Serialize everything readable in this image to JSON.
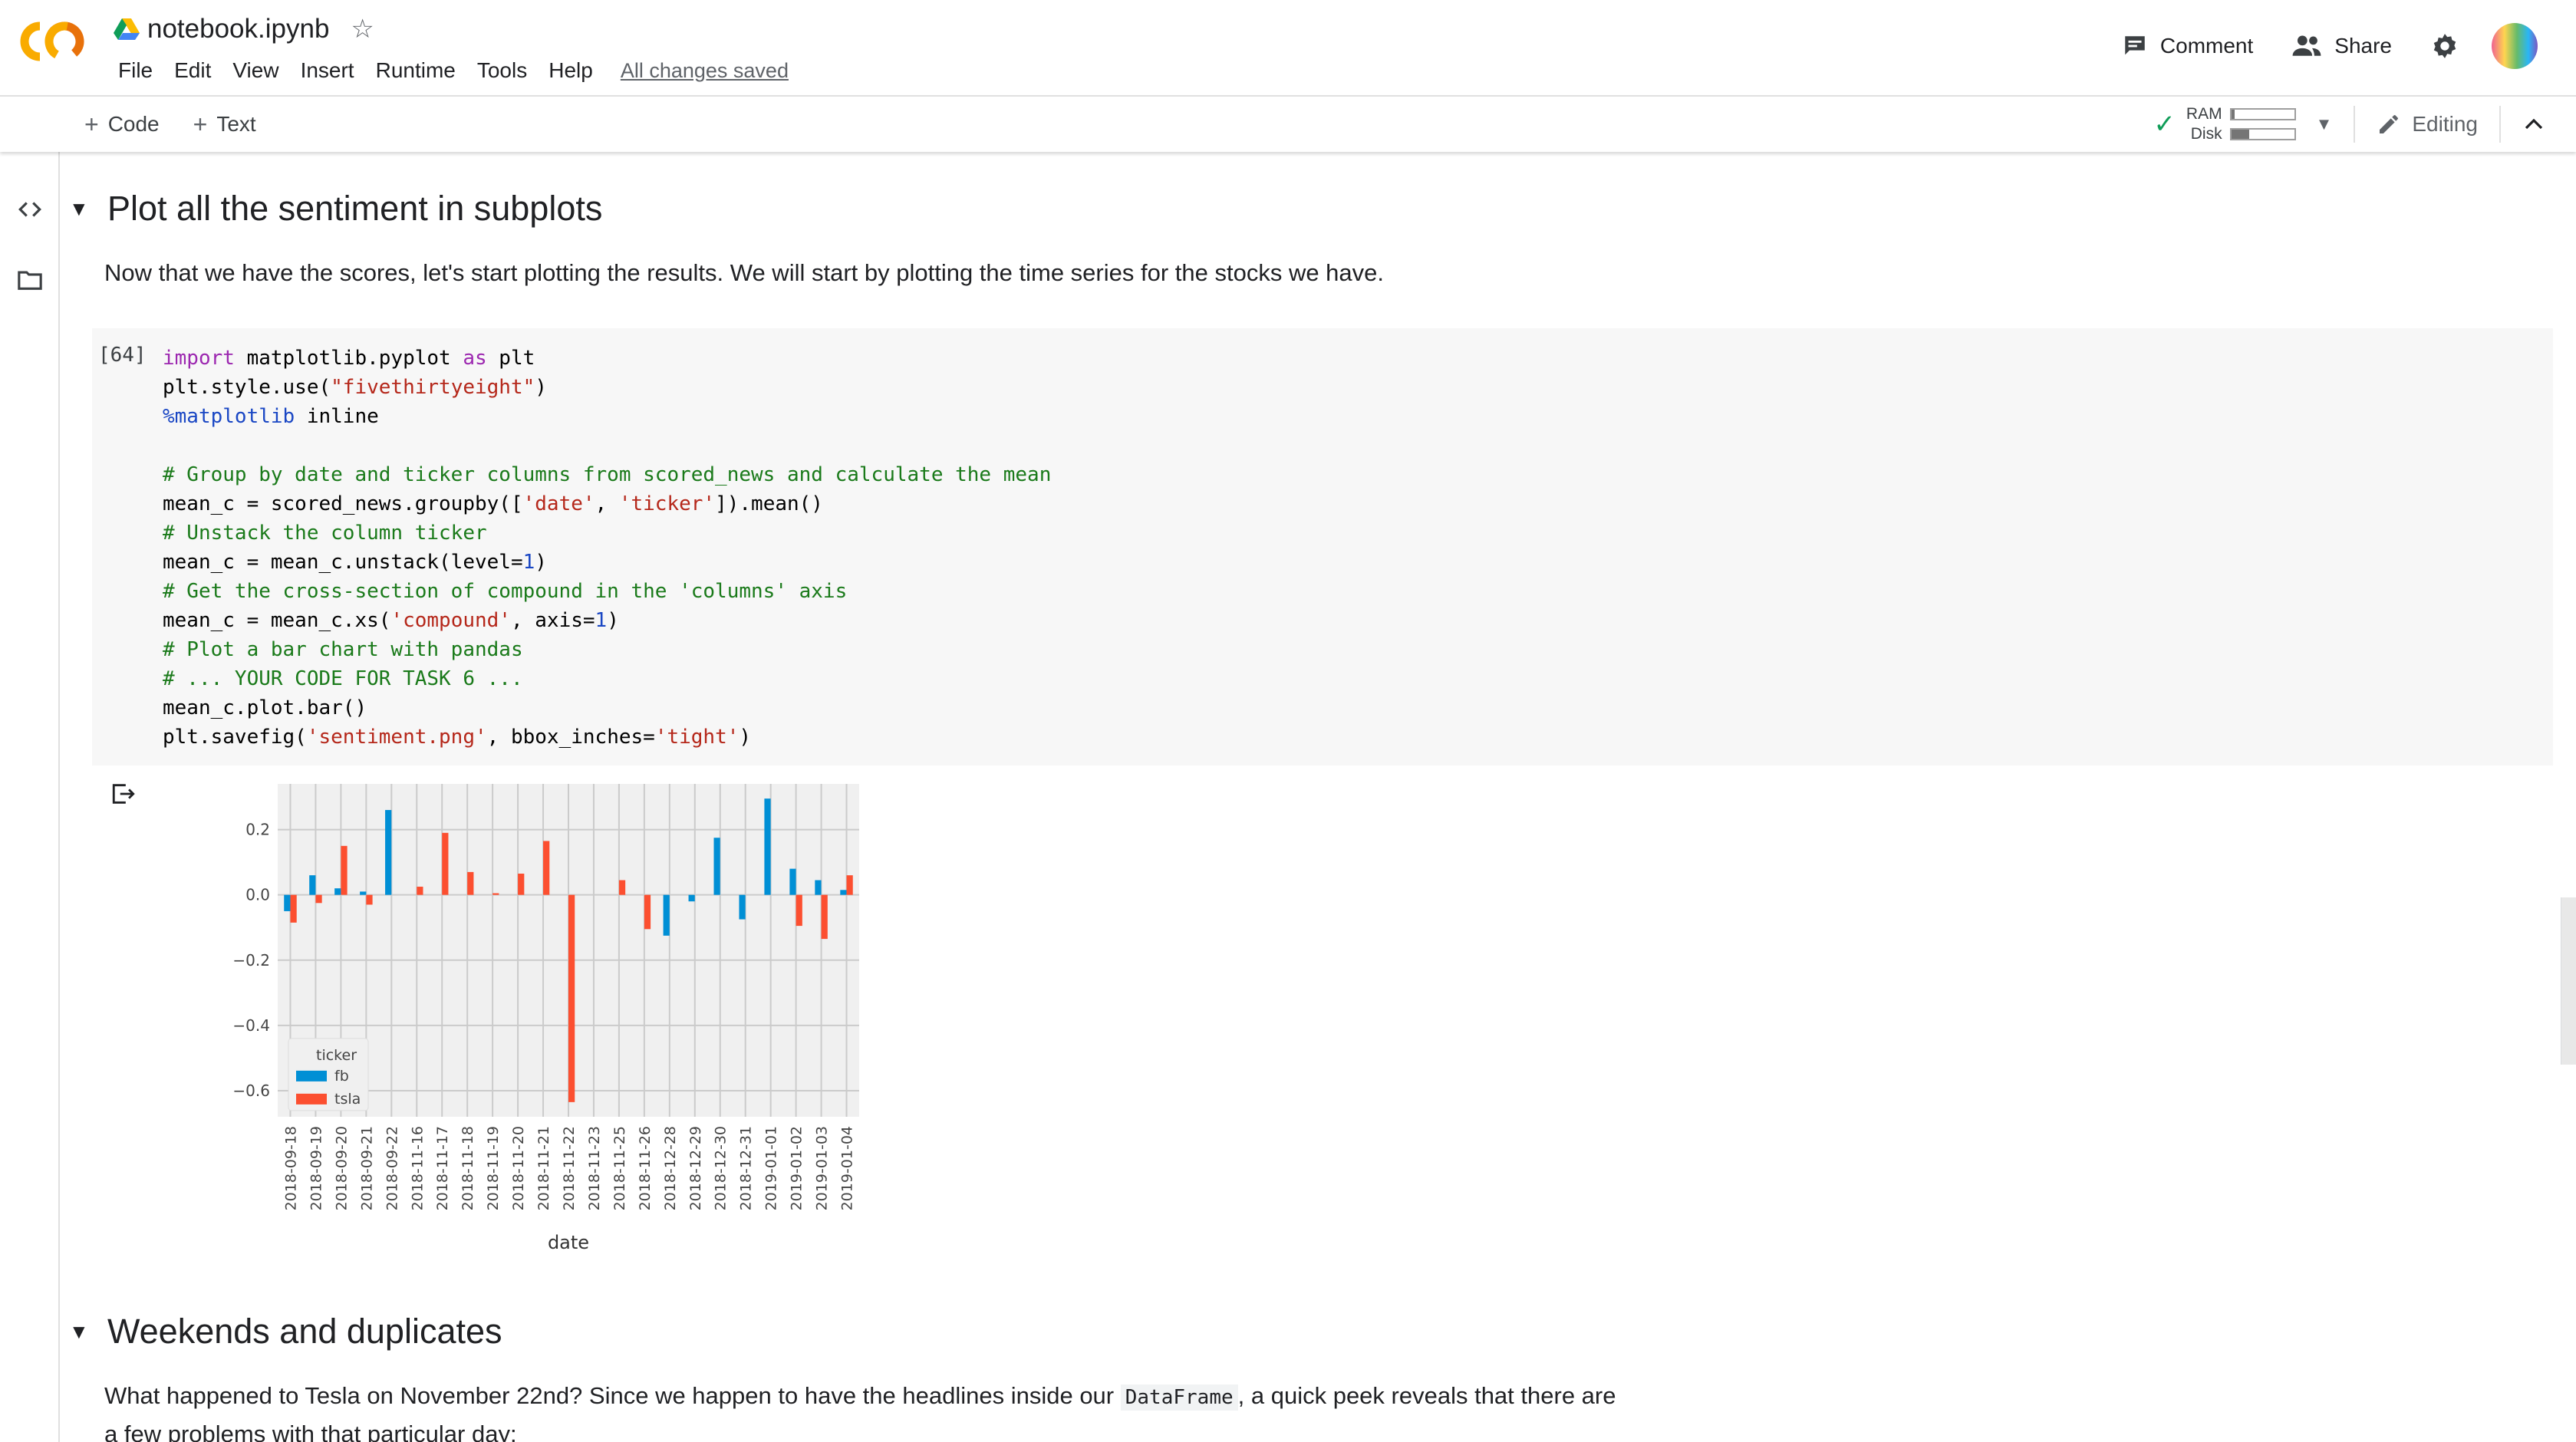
{
  "app": {
    "notebook_title": "notebook.ipynb",
    "menu": [
      "File",
      "Edit",
      "View",
      "Insert",
      "Runtime",
      "Tools",
      "Help"
    ],
    "save_status": "All changes saved",
    "comment_label": "Comment",
    "share_label": "Share"
  },
  "toolbar": {
    "code_label": "Code",
    "text_label": "Text",
    "ram_label": "RAM",
    "disk_label": "Disk",
    "ram_fill": 0.05,
    "disk_fill": 0.28,
    "editing_label": "Editing"
  },
  "section1": {
    "title": "Plot all the sentiment in subplots",
    "text": "Now that we have the scores, let's start plotting the results. We will start by plotting the time series for the stocks we have."
  },
  "code_cell": {
    "exec_count": "[64]",
    "lines": [
      [
        [
          "kw",
          "import"
        ],
        [
          "t",
          " matplotlib.pyplot "
        ],
        [
          "kw",
          "as"
        ],
        [
          "t",
          " plt"
        ]
      ],
      [
        [
          "t",
          "plt.style.use("
        ],
        [
          "str",
          "\"fivethirtyeight\""
        ],
        [
          "t",
          ")"
        ]
      ],
      [
        [
          "magic",
          "%matplotlib"
        ],
        [
          "t",
          " inline"
        ]
      ],
      [],
      [
        [
          "cm",
          "# Group by date and ticker columns from scored_news and calculate the mean"
        ]
      ],
      [
        [
          "t",
          "mean_c = scored_news.groupby(["
        ],
        [
          "str",
          "'date'"
        ],
        [
          "t",
          ", "
        ],
        [
          "str",
          "'ticker'"
        ],
        [
          "t",
          "]).mean()"
        ]
      ],
      [
        [
          "cm",
          "# Unstack the column ticker"
        ]
      ],
      [
        [
          "t",
          "mean_c = mean_c.unstack(level="
        ],
        [
          "num",
          "1"
        ],
        [
          "t",
          ")"
        ]
      ],
      [
        [
          "cm",
          "# Get the cross-section of compound in the 'columns' axis"
        ]
      ],
      [
        [
          "t",
          "mean_c = mean_c.xs("
        ],
        [
          "str",
          "'compound'"
        ],
        [
          "t",
          ", axis="
        ],
        [
          "num",
          "1"
        ],
        [
          "t",
          ")"
        ]
      ],
      [
        [
          "cm",
          "# Plot a bar chart with pandas"
        ]
      ],
      [
        [
          "cm",
          "# ... YOUR CODE FOR TASK 6 ..."
        ]
      ],
      [
        [
          "t",
          "mean_c.plot.bar()"
        ]
      ],
      [
        [
          "t",
          "plt.savefig("
        ],
        [
          "str",
          "'sentiment.png'"
        ],
        [
          "t",
          ", bbox_inches="
        ],
        [
          "str",
          "'tight'"
        ],
        [
          "t",
          ")"
        ]
      ]
    ]
  },
  "chart_data": {
    "type": "bar",
    "categories": [
      "2018-09-18",
      "2018-09-19",
      "2018-09-20",
      "2018-09-21",
      "2018-09-22",
      "2018-11-16",
      "2018-11-17",
      "2018-11-18",
      "2018-11-19",
      "2018-11-20",
      "2018-11-21",
      "2018-11-22",
      "2018-11-23",
      "2018-11-25",
      "2018-11-26",
      "2018-12-28",
      "2018-12-29",
      "2018-12-30",
      "2018-12-31",
      "2019-01-01",
      "2019-01-02",
      "2019-01-03",
      "2019-01-04"
    ],
    "series": [
      {
        "name": "fb",
        "color": "#008fd5",
        "values": [
          -0.05,
          0.06,
          0.02,
          0.01,
          0.26,
          0,
          0,
          0,
          0,
          0,
          0,
          0,
          0,
          0,
          0,
          -0.125,
          -0.02,
          0.175,
          -0.075,
          0.295,
          0.08,
          0.045,
          0.015
        ]
      },
      {
        "name": "tsla",
        "color": "#fc4f30",
        "values": [
          -0.085,
          -0.025,
          0.15,
          -0.03,
          0,
          0.025,
          0.19,
          0.07,
          0.005,
          0.065,
          0.165,
          -0.635,
          0,
          0.045,
          -0.105,
          0,
          0,
          0,
          0,
          0,
          -0.095,
          -0.135,
          0.06
        ]
      }
    ],
    "xlabel": "date",
    "ylabel": "",
    "ylim": [
      -0.68,
      0.34
    ],
    "yticks": [
      "0.2",
      "0.0",
      "−0.2",
      "−0.4",
      "−0.6"
    ],
    "ytick_values": [
      0.2,
      0.0,
      -0.2,
      -0.4,
      -0.6
    ],
    "legend_title": "ticker",
    "legend_position": "lower-left",
    "grid": true
  },
  "section2": {
    "title": "Weekends and duplicates",
    "text_before": "What happened to Tesla on November 22nd? Since we happen to have the headlines inside our ",
    "code": "DataFrame",
    "text_after": ", a quick peek reveals that there are",
    "text_line2": "a few problems with that particular day:"
  }
}
